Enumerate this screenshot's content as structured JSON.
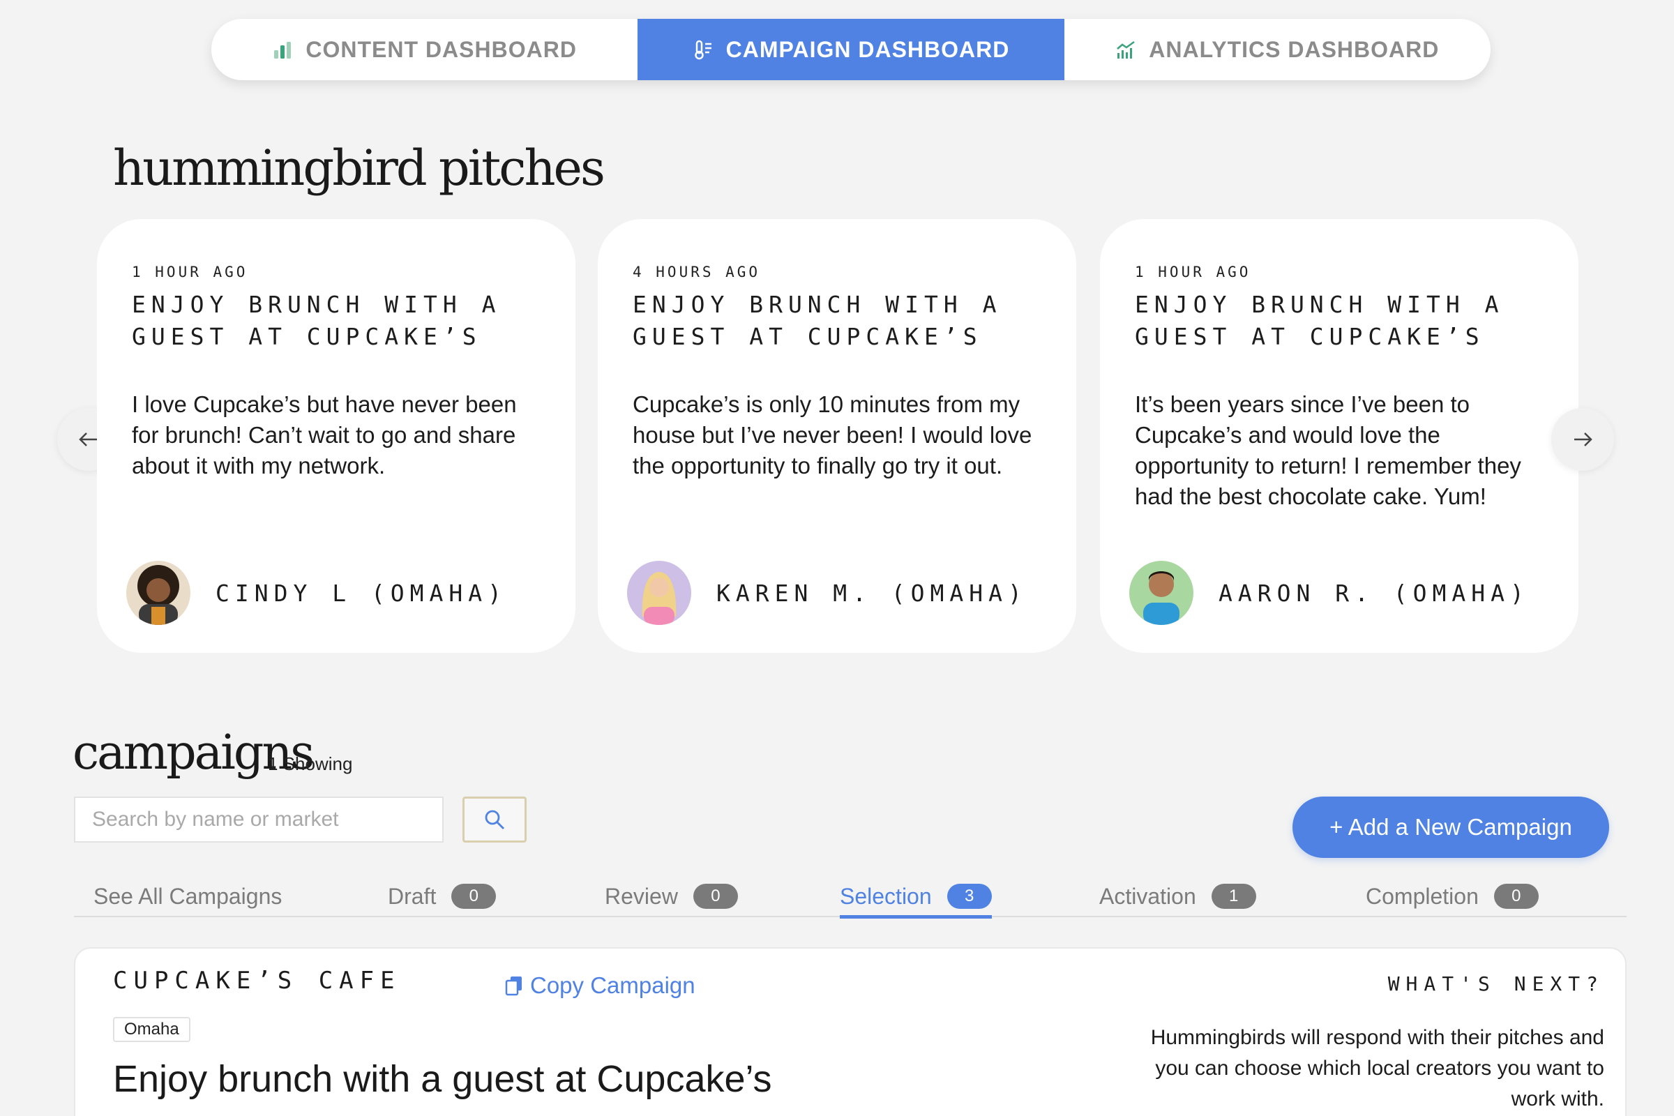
{
  "nav": {
    "tabs": [
      {
        "label": "CONTENT DASHBOARD",
        "icon": "bar-chart-icon",
        "active": false
      },
      {
        "label": "CAMPAIGN DASHBOARD",
        "icon": "thermometer-icon",
        "active": true
      },
      {
        "label": "ANALYTICS DASHBOARD",
        "icon": "trend-chart-icon",
        "active": false
      }
    ]
  },
  "pitches": {
    "title": "hummingbird pitches",
    "cards": [
      {
        "time": "1 HOUR AGO",
        "headline": "ENJOY BRUNCH WITH A GUEST AT CUPCAKE’S",
        "body": "I love Cupcake’s but have never been for brunch! Can’t wait to go and share about it with my network.",
        "author": "CINDY L (OMAHA)"
      },
      {
        "time": "4 HOURS AGO",
        "headline": "ENJOY BRUNCH WITH A GUEST AT CUPCAKE’S",
        "body": "Cupcake’s is only 10 minutes from my house but I’ve never been! I would love the opportunity to finally go try it out.",
        "author": "KAREN M. (OMAHA)"
      },
      {
        "time": "1 HOUR AGO",
        "headline": "ENJOY BRUNCH WITH A GUEST AT CUPCAKE’S",
        "body": "It’s been years since I’ve been to Cupcake’s and would love the opportunity to return! I remember they had the best chocolate cake. Yum!",
        "author": "AARON R. (OMAHA)"
      }
    ]
  },
  "campaigns": {
    "title": "campaigns",
    "showing": "1 Showing",
    "search_placeholder": "Search by name or market",
    "add_button": "+ Add a New Campaign",
    "filters": [
      {
        "label": "See All Campaigns"
      },
      {
        "label": "Draft",
        "count": "0"
      },
      {
        "label": "Review",
        "count": "0"
      },
      {
        "label": "Selection",
        "count": "3",
        "active": true
      },
      {
        "label": "Activation",
        "count": "1"
      },
      {
        "label": "Completion",
        "count": "0"
      }
    ],
    "card": {
      "name": "CUPCAKE’S CAFE",
      "copy_label": "Copy Campaign",
      "market": "Omaha",
      "title": "Enjoy brunch with a guest at Cupcake’s",
      "next_heading": "WHAT'S NEXT?",
      "next_text": "Hummingbirds will respond with their pitches and you can choose which local creators you want to work with."
    }
  },
  "colors": {
    "accent": "#4f82e3",
    "background": "#f3f3f3",
    "badge_gray": "#7a7a7a"
  }
}
